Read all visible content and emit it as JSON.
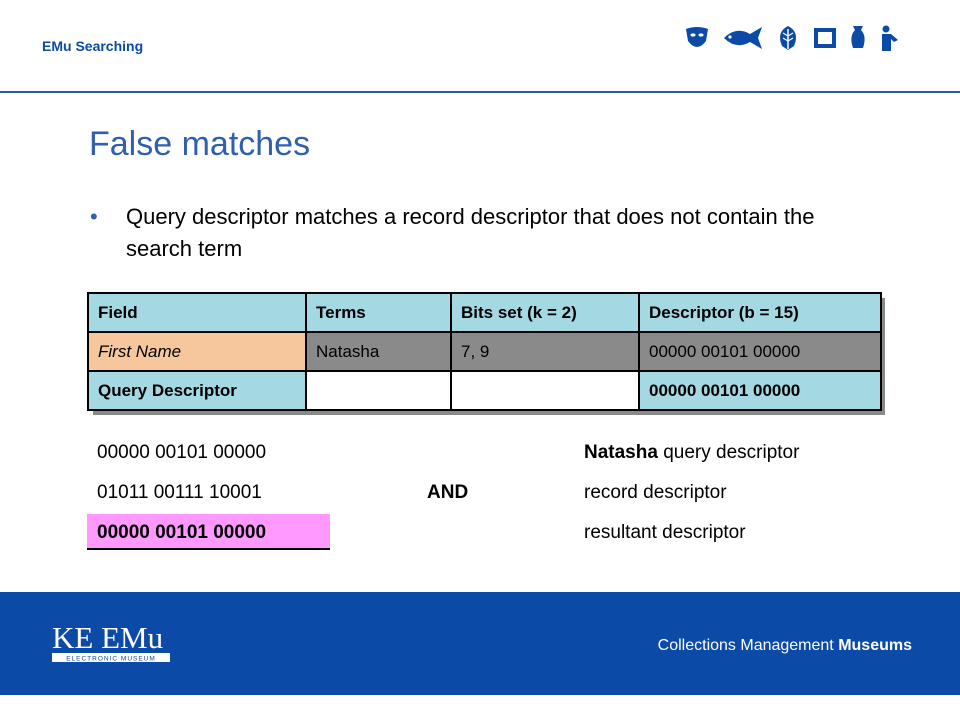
{
  "header": {
    "title": "EMu Searching",
    "icons": [
      "mask-icon",
      "fish-icon",
      "leaf-icon",
      "frame-icon",
      "vase-icon",
      "figure-icon"
    ]
  },
  "slide": {
    "title": "False matches",
    "bullet_marker": "•",
    "bullet": "Query descriptor matches a record descriptor that does not contain the search term"
  },
  "table": {
    "headers": [
      "Field",
      "Terms",
      "Bits set (k = 2)",
      "Descriptor (b = 15)"
    ],
    "row1": [
      "First Name",
      "Natasha",
      "7, 9",
      "00000 00101 00000"
    ],
    "row2": [
      "Query Descriptor",
      "",
      "",
      "00000 00101 00000"
    ]
  },
  "calc": {
    "row1": {
      "bits": "00000 00101 00000",
      "op": "",
      "desc_bold": "Natasha",
      "desc": " query descriptor"
    },
    "row2": {
      "bits": "01011 00111 10001",
      "op": "AND",
      "desc": "record descriptor"
    },
    "row3": {
      "bits": "00000 00101 00000",
      "op": "",
      "desc": "resultant descriptor"
    }
  },
  "footer": {
    "logo_text": "KE EMu",
    "logo_subtext": "ELECTRONIC MUSEUM",
    "tagline_plain": "Collections Management ",
    "tagline_bold": "Museums"
  },
  "colors": {
    "brand_blue": "#0b4aa6",
    "title_blue": "#2f5fae",
    "header_cell": "#a4d8e2",
    "peach_cell": "#f6c79c",
    "pink_highlight": "#ff99ff"
  }
}
